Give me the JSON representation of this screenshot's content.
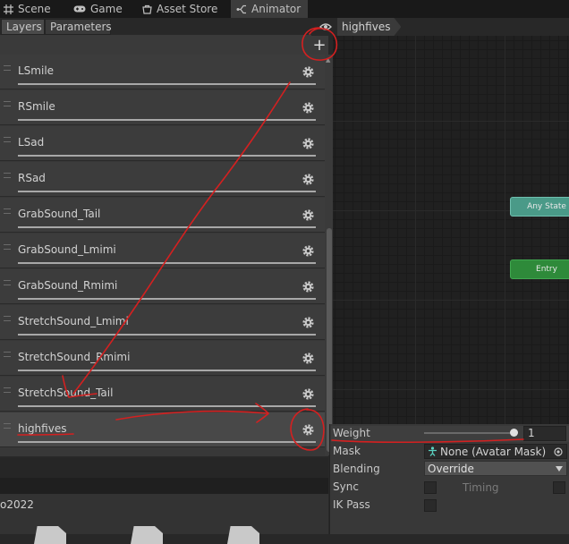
{
  "window_tabs": [
    {
      "label": "Scene",
      "icon": "grid-icon"
    },
    {
      "label": "Game",
      "icon": "gamepad-icon"
    },
    {
      "label": "Asset Store",
      "icon": "store-icon"
    },
    {
      "label": "Animator",
      "icon": "animator-icon",
      "active": true
    }
  ],
  "left_panel": {
    "tabs": [
      "Layers",
      "Parameters"
    ],
    "add_button": "+",
    "layers": [
      {
        "name": "LSmile"
      },
      {
        "name": "RSmile"
      },
      {
        "name": "LSad"
      },
      {
        "name": "RSad"
      },
      {
        "name": "GrabSound_Tail"
      },
      {
        "name": "GrabSound_Lmimi"
      },
      {
        "name": "GrabSound_Rmimi"
      },
      {
        "name": "StretchSound_Lmimi"
      },
      {
        "name": "StretchSound_Rmimi"
      },
      {
        "name": "StretchSound_Tail"
      },
      {
        "name": "highfives",
        "selected": true
      }
    ]
  },
  "graph": {
    "breadcrumb": "highfives",
    "nodes": {
      "any_state": "Any State",
      "entry": "Entry"
    }
  },
  "inspector": {
    "weight_label": "Weight",
    "weight_value": "1",
    "weight_slider_fraction": 1.0,
    "mask_label": "Mask",
    "mask_value": "None (Avatar Mask)",
    "blending_label": "Blending",
    "blending_value": "Override",
    "sync_label": "Sync",
    "timing_label": "Timing",
    "ikpass_label": "IK Pass"
  },
  "project_panel": {
    "name": "o2022"
  },
  "annotation_color": "#d42020"
}
